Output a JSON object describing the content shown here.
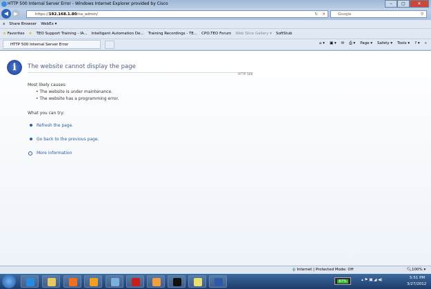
{
  "window": {
    "title": "HTTP 500 Internal Server Error - Windows Internet Explorer provided by Cisco",
    "minimize": "–",
    "maximize": "▢",
    "close": "✕"
  },
  "nav": {
    "back": "◀",
    "forward": "▶",
    "address_prefix": "https://",
    "address_host": "192.168.1.80",
    "address_path": "/na_admin/",
    "search_placeholder": "Google",
    "refresh": "↻",
    "stop": "✕",
    "search_icon": "⚲"
  },
  "toolbar1": {
    "close": "x",
    "share_browser": "Share Browser",
    "webex": "WebEx ▾"
  },
  "favorites": {
    "label": "Favorites",
    "items": [
      "TEO Support Training - IA...",
      "Intelligent Automation De...",
      "Training Recordings - TE...",
      "CPO.TEO Forum",
      "Web Slice Gallery ▾",
      "SoftStub"
    ]
  },
  "tab": {
    "label": "HTTP 500 Internal Server Error"
  },
  "commands": {
    "home": "⌂ ▾",
    "feeds": "▣ ▾",
    "mail": "✉",
    "print": "⎙ ▾",
    "page": "Page ▾",
    "safety": "Safety ▾",
    "tools": "Tools ▾",
    "help": "? ▾",
    "more": "»"
  },
  "page": {
    "heading": "The website cannot display the page",
    "code": "HTTP 500",
    "causes_label": "Most likely causes:",
    "causes": [
      "The website is under maintenance.",
      "The website has a programming error."
    ],
    "try_label": "What you can try:",
    "actions": [
      "Refresh the page.",
      "Go back to the previous page.",
      "More information"
    ]
  },
  "status": {
    "zone": "Internet | Protected Mode: Off",
    "zoom": "100%"
  },
  "taskbar": {
    "battery": "67%",
    "time": "5:51 PM",
    "date": "3/27/2012"
  }
}
